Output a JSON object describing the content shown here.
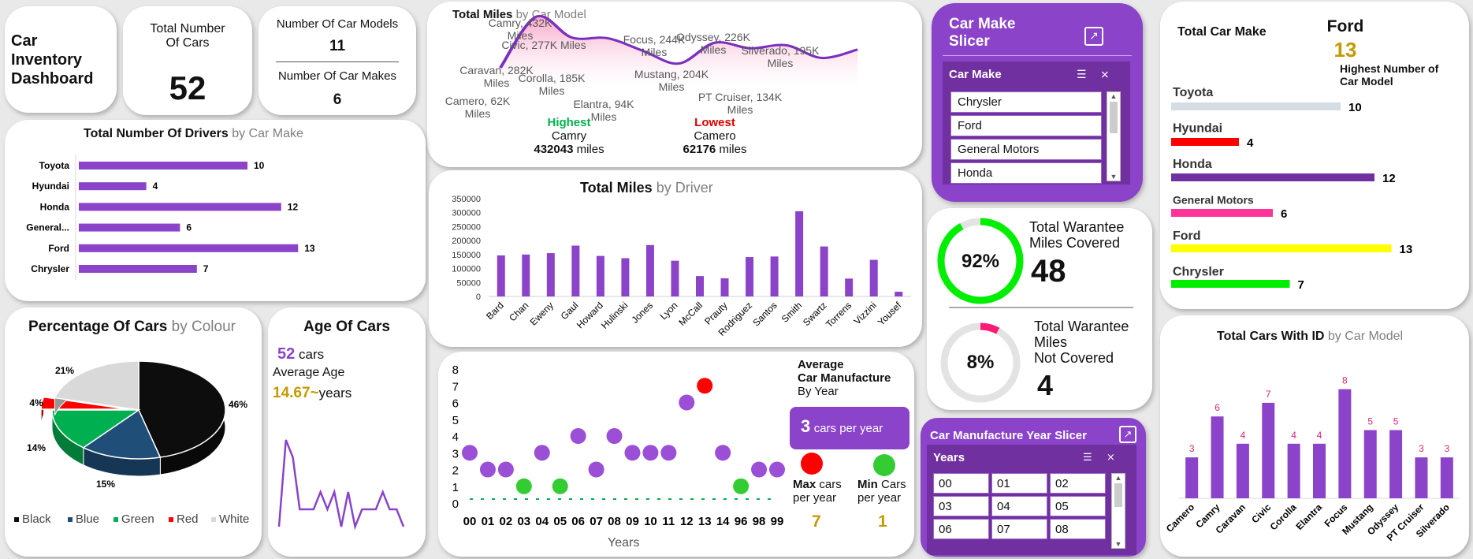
{
  "title": {
    "line1": "Car",
    "line2": "Inventory",
    "line3": "Dashboard"
  },
  "kpi_cars": {
    "label1": "Total Number",
    "label2": "Of Cars",
    "value": "52"
  },
  "kpi_models": {
    "label": "Number Of Car Models",
    "value": "11",
    "label2": "Number Of Car Makes",
    "value2": "6"
  },
  "miles_model": {
    "title_bold": "Total Miles",
    "title_light": "by Car Model",
    "highest_label": "Highest",
    "highest_name": "Camry",
    "highest_value": "432043",
    "highest_unit": "miles",
    "lowest_label": "Lowest",
    "lowest_name": "Camero",
    "lowest_value": "62176",
    "lowest_unit": "miles",
    "labels": [
      {
        "a": "Camero, 62K",
        "b": "Miles"
      },
      {
        "a": "Camry, 432K",
        "b": "Miles"
      },
      {
        "a": "Caravan, 282K",
        "b": "Miles"
      },
      {
        "a": "Civic, 277K Miles",
        "b": ""
      },
      {
        "a": "Corolla, 185K",
        "b": "Miles"
      },
      {
        "a": "Elantra, 94K",
        "b": "Miles"
      },
      {
        "a": "Focus, 244K",
        "b": "Miles"
      },
      {
        "a": "Mustang, 204K",
        "b": "Miles"
      },
      {
        "a": "Odyssey, 226K",
        "b": "Miles"
      },
      {
        "a": "PT Cruiser, 134K",
        "b": "Miles"
      },
      {
        "a": "Silverado, 195K",
        "b": "Miles"
      }
    ]
  },
  "make_slicer": {
    "title1": "Car Make",
    "title2": "Slicer",
    "header": "Car Make",
    "items": [
      "Chrysler",
      "Ford",
      "General Motors",
      "Honda"
    ]
  },
  "total_make": {
    "title": "Total Car Make",
    "top_name": "Ford",
    "top_value": "13",
    "top_label1": "Highest Number of",
    "top_label2": "Car Model"
  },
  "drivers": {
    "title_bold": "Total Number Of Drivers",
    "title_light": "by Car Make"
  },
  "miles_driver": {
    "title_bold": "Total Miles",
    "title_light": "by Driver"
  },
  "warranty": {
    "covered_pct": "92%",
    "covered_l1": "Total Warantee",
    "covered_l2": "Miles Covered",
    "covered_value": "48",
    "not_pct": "8%",
    "not_l1": "Total Warantee",
    "not_l2": "Miles",
    "not_l3": "Not Covered",
    "not_value": "4"
  },
  "colour_pie": {
    "title_bold": "Percentage Of Cars",
    "title_light": "by Colour"
  },
  "age": {
    "title": "Age Of Cars",
    "count": "52",
    "count_unit": "cars",
    "avg_label": "Average Age",
    "avg_value": "14.67",
    "avg_tilde": "~",
    "avg_unit": "years"
  },
  "year_chart": {
    "xlabel": "Years",
    "side_title1": "Average",
    "side_title2": "Car Manufacture",
    "side_title3": "By Year",
    "rate_value": "3",
    "rate_unit": "cars per year",
    "max_label": "Max",
    "max_unit": "cars",
    "max_unit2": "per year",
    "max_value": "7",
    "min_label": "Min",
    "min_unit": "Cars",
    "min_unit2": "per year",
    "min_value": "1"
  },
  "year_slicer": {
    "title": "Car Manufacture Year Slicer",
    "header": "Years",
    "items": [
      "00",
      "01",
      "02",
      "03",
      "04",
      "05",
      "06",
      "07",
      "08"
    ]
  },
  "cars_id": {
    "title_bold": "Total Cars With ID",
    "title_light": "by Car Model"
  },
  "colors": {
    "accent": "#8a43c9",
    "high": "#00b050",
    "low": "#e00000",
    "gold": "#c49a00"
  },
  "chart_data": [
    {
      "id": "miles_by_model",
      "type": "area",
      "categories": [
        "Camero",
        "Camry",
        "Caravan",
        "Civic",
        "Corolla",
        "Elantra",
        "Focus",
        "Mustang",
        "Odyssey",
        "PT Cruiser",
        "Silverado"
      ],
      "values": [
        62176,
        432043,
        282000,
        277000,
        185000,
        94000,
        244000,
        204000,
        226000,
        134000,
        195000
      ]
    },
    {
      "id": "drivers_by_make",
      "type": "bar",
      "categories": [
        "Toyota",
        "Hyundai",
        "Honda",
        "General...",
        "Ford",
        "Chrysler"
      ],
      "values": [
        10,
        4,
        12,
        6,
        13,
        7
      ]
    },
    {
      "id": "miles_by_driver",
      "type": "bar",
      "categories": [
        "Bard",
        "Chan",
        "Eweny",
        "Gaul",
        "Howard",
        "Hulinski",
        "Jones",
        "Lyon",
        "McCall",
        "Prauty",
        "Rodriguez",
        "Santos",
        "Smith",
        "Swartz",
        "Torrens",
        "Vizzini",
        "Yousef"
      ],
      "values": [
        147000,
        150000,
        155000,
        182000,
        145000,
        137000,
        184000,
        128000,
        73000,
        65000,
        141000,
        143000,
        305000,
        179000,
        64000,
        131000,
        17000
      ],
      "ylim": [
        0,
        350000
      ],
      "yticks": [
        0,
        50000,
        100000,
        150000,
        200000,
        250000,
        300000,
        350000
      ]
    },
    {
      "id": "cars_by_colour",
      "type": "pie",
      "legend": [
        "Black",
        "Blue",
        "Green",
        "Red",
        "White"
      ],
      "values": [
        46,
        15,
        14,
        4,
        21
      ],
      "labels": [
        "46%",
        "15%",
        "14%",
        "4%",
        "21%"
      ],
      "colors": [
        "#0d0d0d",
        "#1f4e79",
        "#00b050",
        "#ff0000",
        "#d9d9d9"
      ]
    },
    {
      "id": "age_of_cars",
      "type": "line",
      "values": [
        1,
        6,
        5,
        2,
        2,
        2,
        3,
        2,
        3,
        1,
        3,
        1,
        2,
        2,
        2,
        3,
        2,
        2,
        1
      ]
    },
    {
      "id": "cars_by_year",
      "type": "scatter",
      "x": [
        "00",
        "01",
        "02",
        "03",
        "04",
        "05",
        "06",
        "07",
        "08",
        "09",
        "10",
        "11",
        "12",
        "13",
        "14",
        "96",
        "98",
        "99"
      ],
      "values": [
        3,
        2,
        2,
        1,
        3,
        1,
        4,
        2,
        4,
        3,
        3,
        3,
        6,
        7,
        3,
        1,
        2,
        2
      ],
      "ylim": [
        0,
        8
      ],
      "yticks": [
        0,
        1,
        2,
        3,
        4,
        5,
        6,
        7,
        8
      ]
    },
    {
      "id": "total_car_make",
      "type": "bar",
      "categories": [
        "Toyota",
        "Hyundai",
        "Honda",
        "General Motors",
        "Ford",
        "Chrysler"
      ],
      "values": [
        10,
        4,
        12,
        6,
        13,
        7
      ],
      "colors": [
        "#d6dce4",
        "#ff0000",
        "#7030a0",
        "#ff3399",
        "#ffff00",
        "#00ee00"
      ]
    },
    {
      "id": "cars_with_id",
      "type": "bar",
      "categories": [
        "Camero",
        "Camry",
        "Caravan",
        "Civic",
        "Corolla",
        "Elantra",
        "Focus",
        "Mustang",
        "Odyssey",
        "PT Cruiser",
        "Silverado"
      ],
      "values": [
        3,
        6,
        4,
        7,
        4,
        4,
        8,
        5,
        5,
        3,
        3
      ]
    }
  ]
}
